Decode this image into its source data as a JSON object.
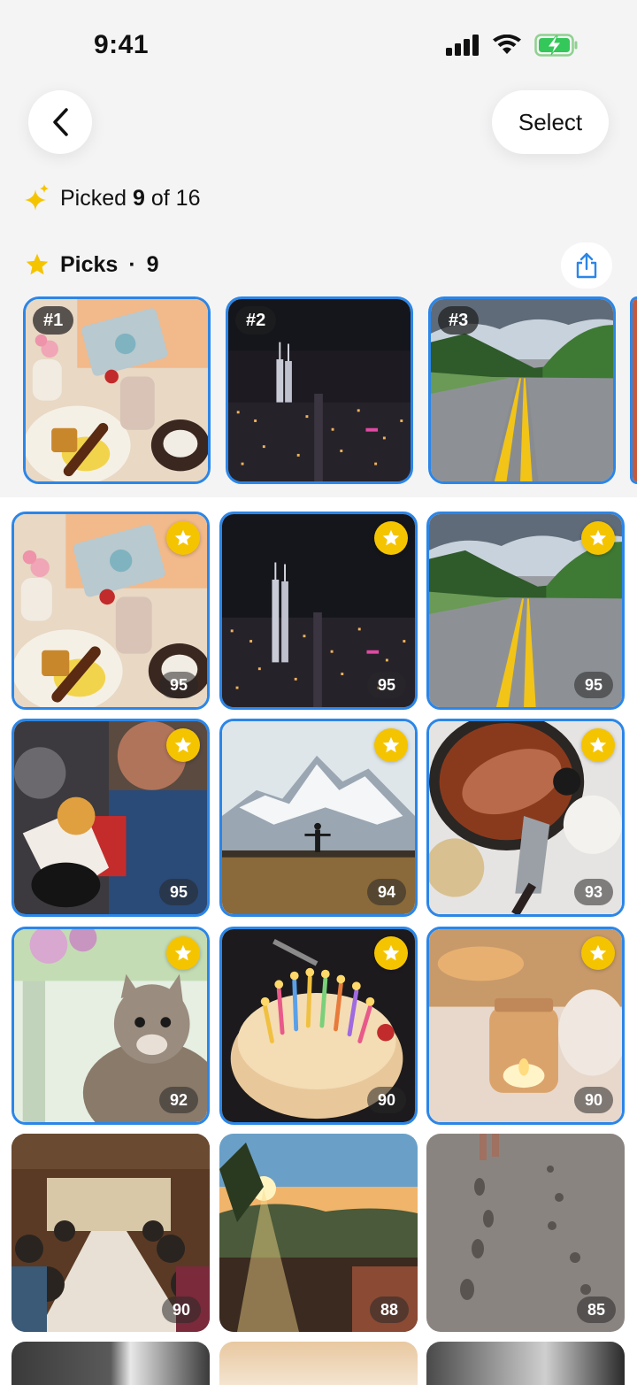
{
  "status": {
    "time": "9:41"
  },
  "nav": {
    "select_label": "Select"
  },
  "summary": {
    "prefix": "Picked",
    "picked": "9",
    "mid": "of",
    "total": "16"
  },
  "picks": {
    "label": "Picks",
    "count": "9",
    "items": [
      {
        "rank": "#1"
      },
      {
        "rank": "#2"
      },
      {
        "rank": "#3"
      }
    ]
  },
  "colors": {
    "accent": "#2b86e8",
    "star": "#f5c400"
  },
  "grid": [
    {
      "score": "95",
      "starred": true,
      "photo": "breakfast"
    },
    {
      "score": "95",
      "starred": true,
      "photo": "city-night"
    },
    {
      "score": "95",
      "starred": true,
      "photo": "road"
    },
    {
      "score": "95",
      "starred": true,
      "photo": "street-food"
    },
    {
      "score": "94",
      "starred": true,
      "photo": "mountain"
    },
    {
      "score": "93",
      "starred": true,
      "photo": "fish-dish"
    },
    {
      "score": "92",
      "starred": true,
      "photo": "cat"
    },
    {
      "score": "90",
      "starred": true,
      "photo": "birthday-cake"
    },
    {
      "score": "90",
      "starred": true,
      "photo": "candle"
    },
    {
      "score": "90",
      "starred": false,
      "photo": "dinner-party"
    },
    {
      "score": "88",
      "starred": false,
      "photo": "sunset-hills"
    },
    {
      "score": "85",
      "starred": false,
      "photo": "footprints"
    }
  ]
}
